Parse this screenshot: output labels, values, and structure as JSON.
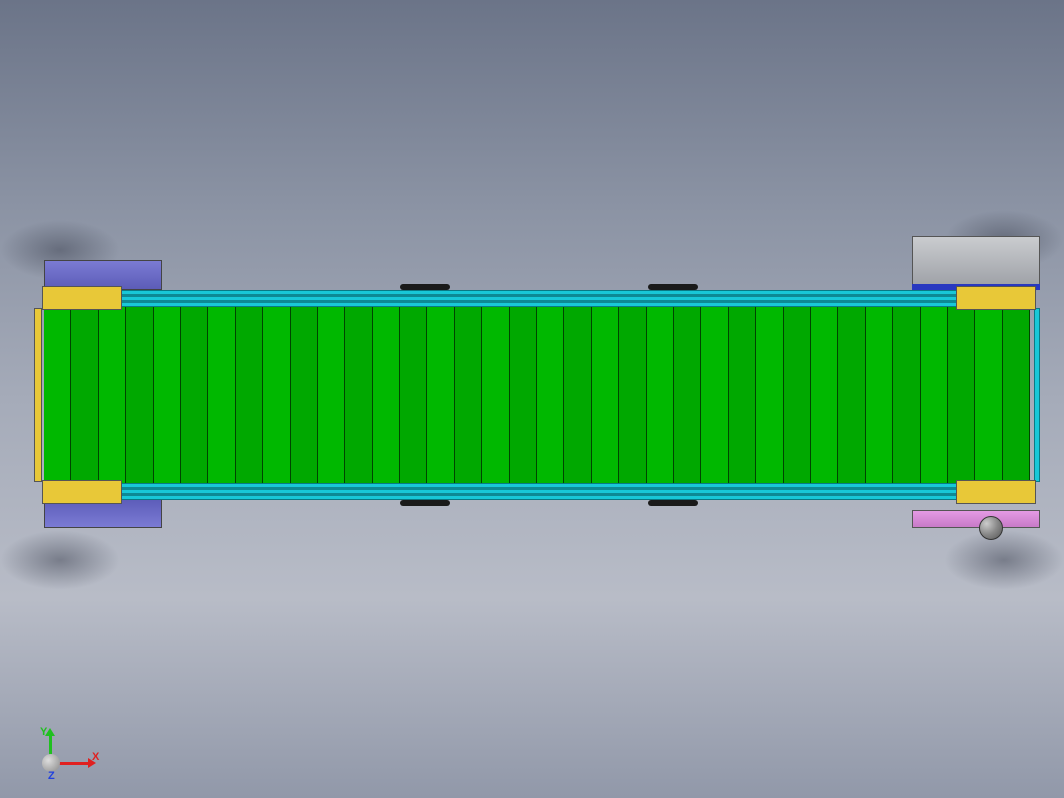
{
  "viewport": {
    "axis_labels": {
      "x": "X",
      "y": "Y",
      "z": "Z"
    }
  },
  "model": {
    "belt_segments": 36
  }
}
